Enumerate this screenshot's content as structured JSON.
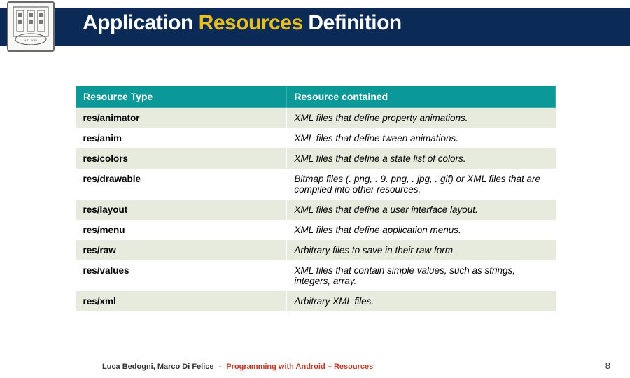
{
  "title": {
    "part1": "Application ",
    "accent": "Resources",
    "part2": " Definition"
  },
  "table": {
    "headers": {
      "type": "Resource Type",
      "desc": "Resource contained"
    },
    "rows": [
      {
        "type": "res/animator",
        "desc": "XML files that define property animations."
      },
      {
        "type": "res/anim",
        "desc": "XML files that define tween animations."
      },
      {
        "type": "res/colors",
        "desc": "XML files that define a state list of colors."
      },
      {
        "type": "res/drawable",
        "desc": "Bitmap files (. png, . 9. png, . jpg, . gif) or XML files that are compiled into other resources."
      },
      {
        "type": "res/layout",
        "desc": "XML files that define a user interface layout."
      },
      {
        "type": "res/menu",
        "desc": "XML files that define application menus."
      },
      {
        "type": "res/raw",
        "desc": "Arbitrary files to save in their raw form."
      },
      {
        "type": "res/values",
        "desc": "XML files that contain simple values, such as strings, integers, array."
      },
      {
        "type": "res/xml",
        "desc": "Arbitrary XML files."
      }
    ]
  },
  "footer": {
    "authors": "Luca Bedogni, Marco Di Felice",
    "sep": "-",
    "course": "Programming with Android – Resources",
    "page": "8"
  }
}
